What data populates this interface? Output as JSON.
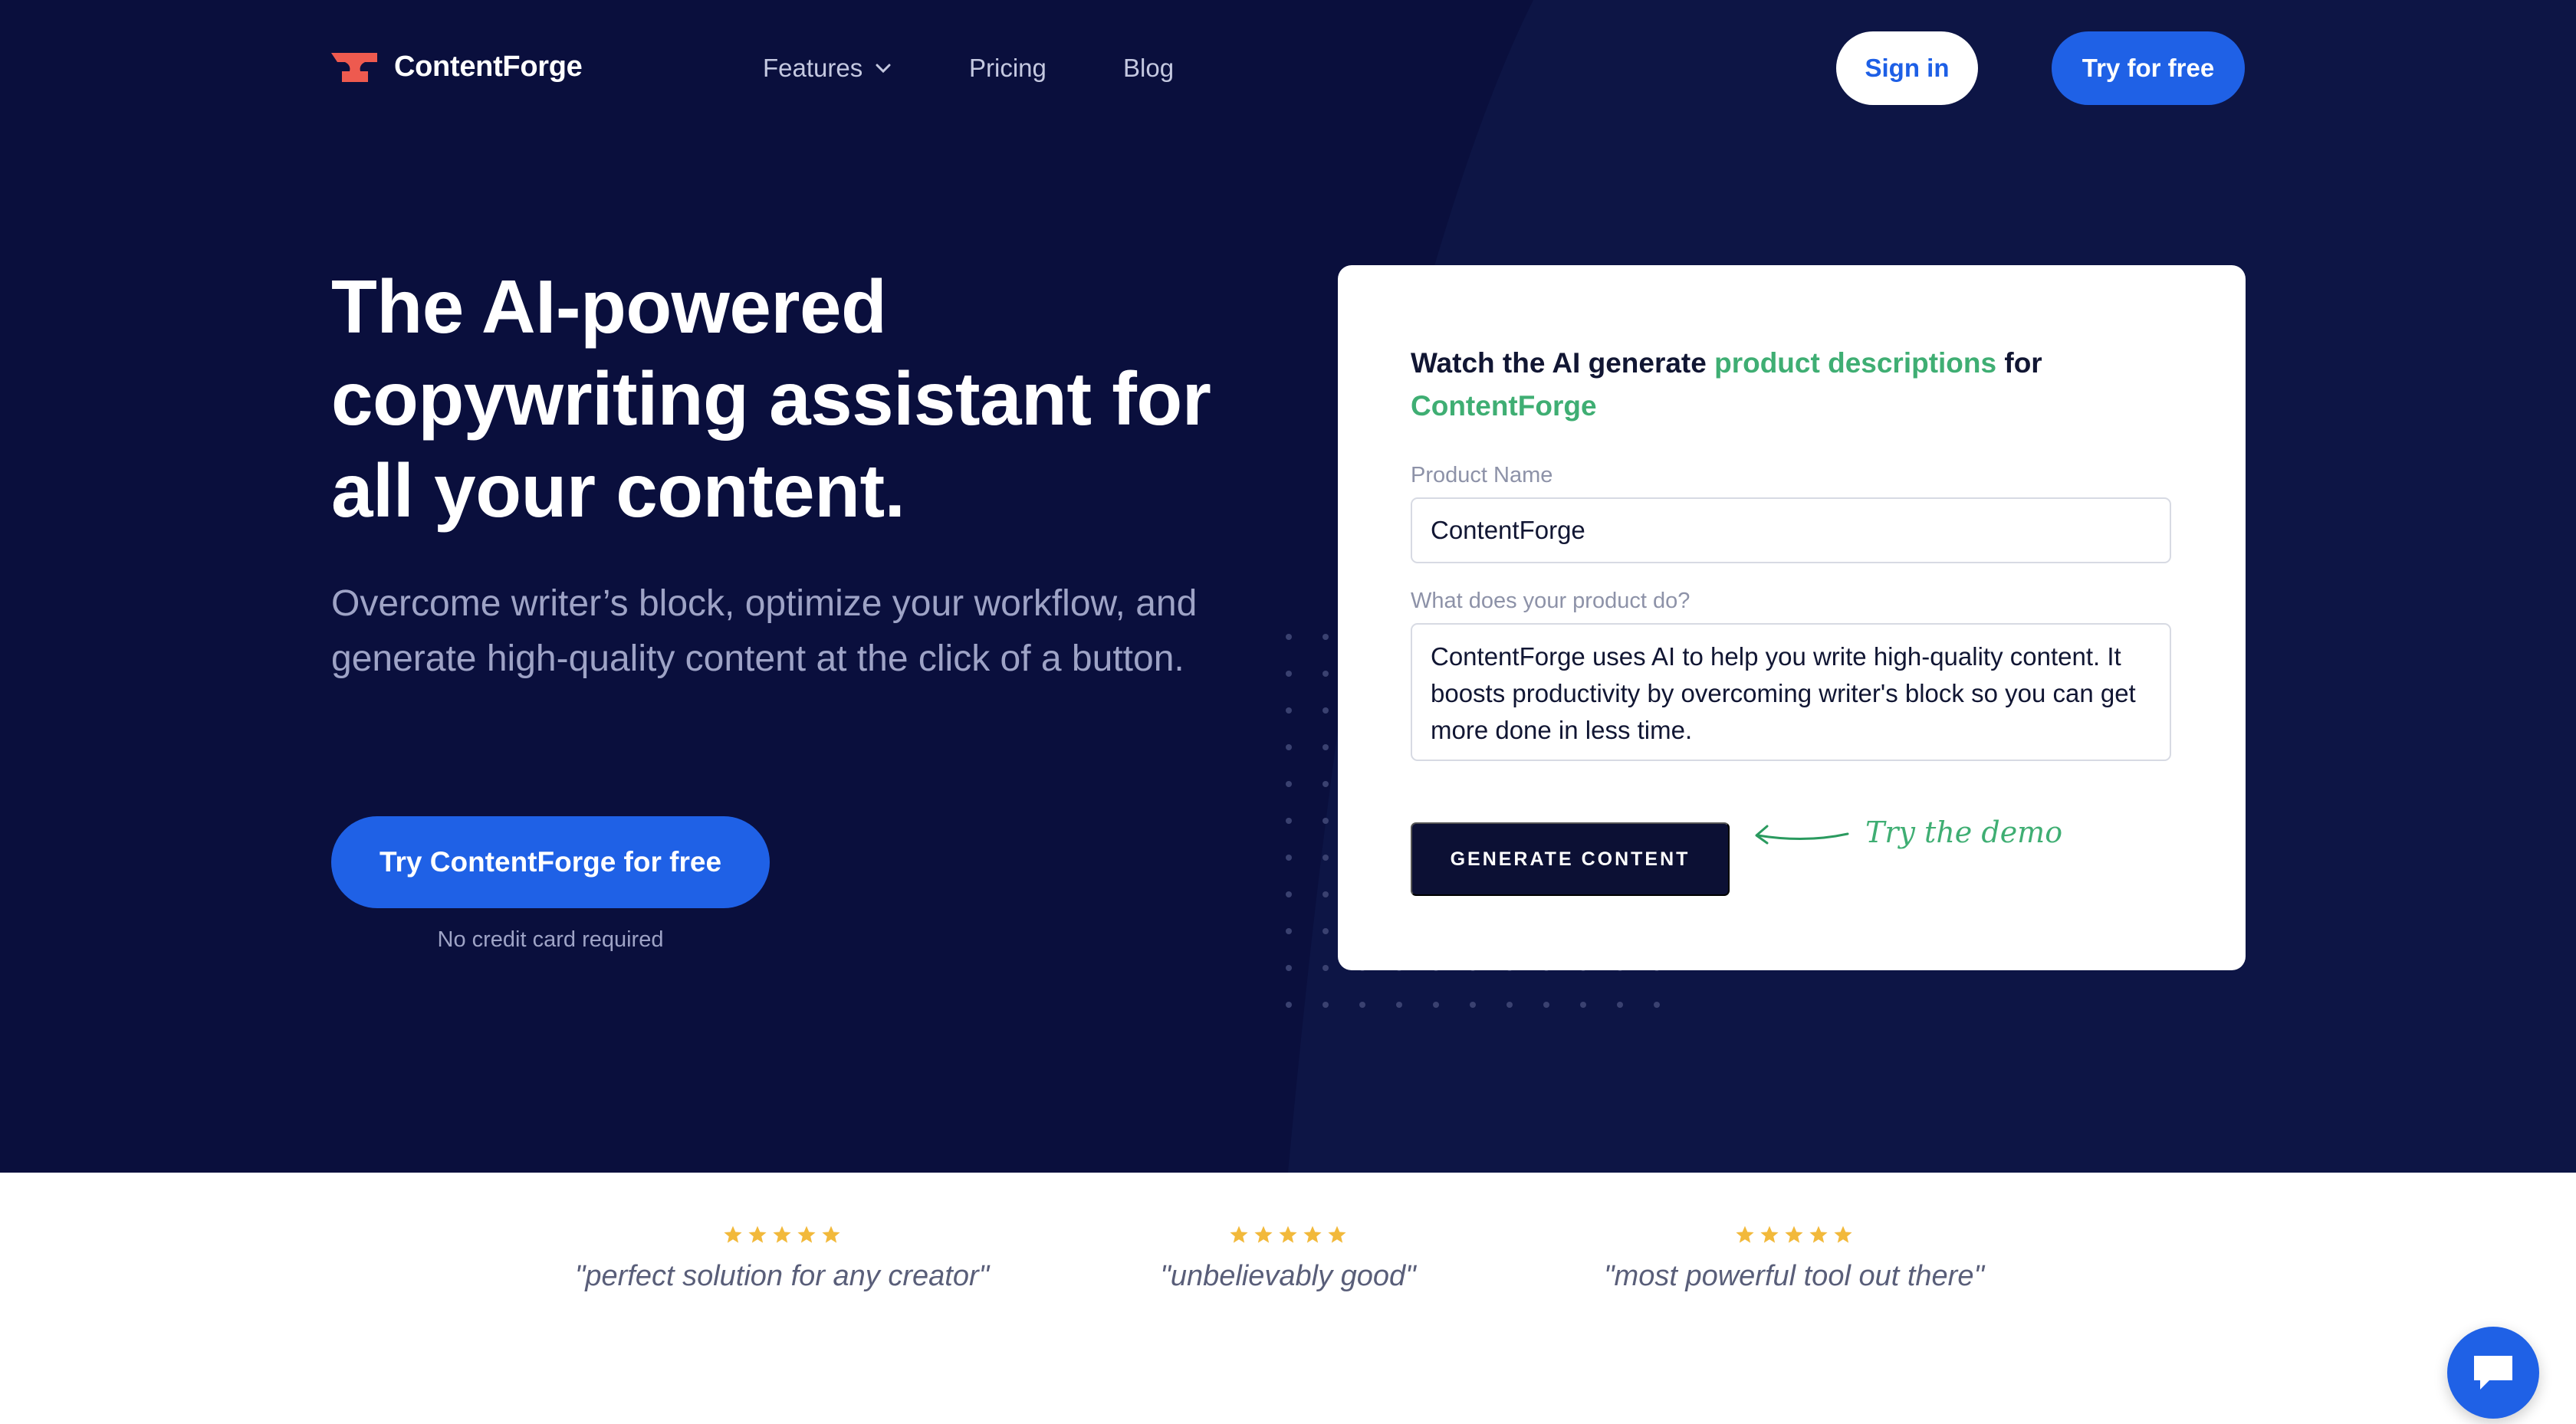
{
  "colors": {
    "hero_bg": "#0a0f3d",
    "accent_blue": "#1f61e6",
    "accent_green": "#3fae73",
    "logo_coral": "#ee5a4f",
    "star_gold": "#f2b93b"
  },
  "nav": {
    "logo_text": "ContentForge",
    "logo_icon": "anvil-icon",
    "links": [
      {
        "label": "Features",
        "icon": "chevron-down-icon"
      },
      {
        "label": "Pricing"
      },
      {
        "label": "Blog"
      }
    ],
    "signin_label": "Sign in",
    "try_label": "Try for free"
  },
  "hero": {
    "headline": "The AI-powered copywriting assistant for all your content.",
    "subtext": "Overcome writer’s block, optimize your workflow, and generate high-quality content at the click of a button.",
    "cta_label": "Try ContentForge for free",
    "cta_note": "No credit card required"
  },
  "demo_card": {
    "title_prefix": "Watch the AI generate ",
    "title_highlight": "product descriptions",
    "title_mid": " for ",
    "title_product": "ContentForge",
    "product_name_label": "Product Name",
    "product_name_value": "ContentForge",
    "description_label": "What does your product do?",
    "description_value": "ContentForge uses AI to help you write high-quality content. It boosts productivity by overcoming writer's block so you can get more done in less time.",
    "generate_label": "GENERATE CONTENT",
    "demo_hint": "Try the demo",
    "demo_hint_icon": "arrow-left-icon"
  },
  "reviews": [
    {
      "rating": 5,
      "text": "\"perfect solution for any creator\""
    },
    {
      "rating": 5,
      "text": "\"unbelievably good\""
    },
    {
      "rating": 5,
      "text": "\"most powerful tool out there\""
    }
  ],
  "chat": {
    "icon": "chat-bubble-icon"
  }
}
